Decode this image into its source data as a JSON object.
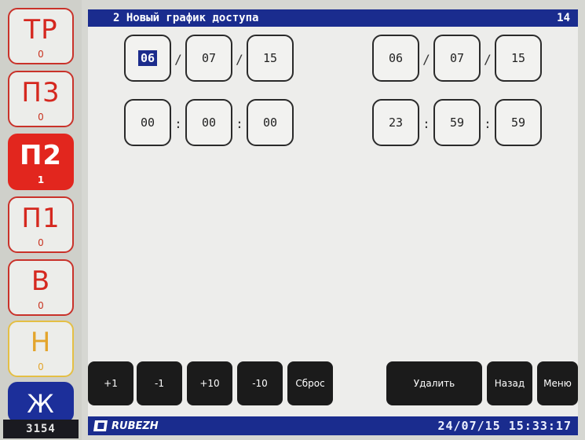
{
  "sidebar": {
    "buttons": [
      {
        "label": "ТР",
        "count": "0"
      },
      {
        "label": "П3",
        "count": "0"
      },
      {
        "label": "П2",
        "count": "1"
      },
      {
        "label": "П1",
        "count": "0"
      },
      {
        "label": "В",
        "count": "0"
      },
      {
        "label": "Н",
        "count": "0"
      }
    ],
    "journal_label": "Ж",
    "event_counter": "3154"
  },
  "header": {
    "title": "2 Новый график доступа",
    "page_number": "14"
  },
  "schedule": {
    "start_date": {
      "day": "06",
      "month": "07",
      "year": "15"
    },
    "end_date": {
      "day": "06",
      "month": "07",
      "year": "15"
    },
    "start_time": {
      "hour": "00",
      "minute": "00",
      "second": "00"
    },
    "end_time": {
      "hour": "23",
      "minute": "59",
      "second": "59"
    },
    "date_separator": "/",
    "time_separator": ":"
  },
  "commands": {
    "plus1": "+1",
    "minus1": "-1",
    "plus10": "+10",
    "minus10": "-10",
    "reset": "Сброс",
    "delete": "Удалить",
    "back": "Назад",
    "menu": "Меню"
  },
  "footer": {
    "brand": "RUBEZH",
    "datetime": "24/07/15 15:33:17"
  },
  "colors": {
    "alarm_red": "#e2261e",
    "warning_yellow": "#e3a52c",
    "header_blue": "#1a2c8e",
    "button_black": "#1b1b1b"
  }
}
